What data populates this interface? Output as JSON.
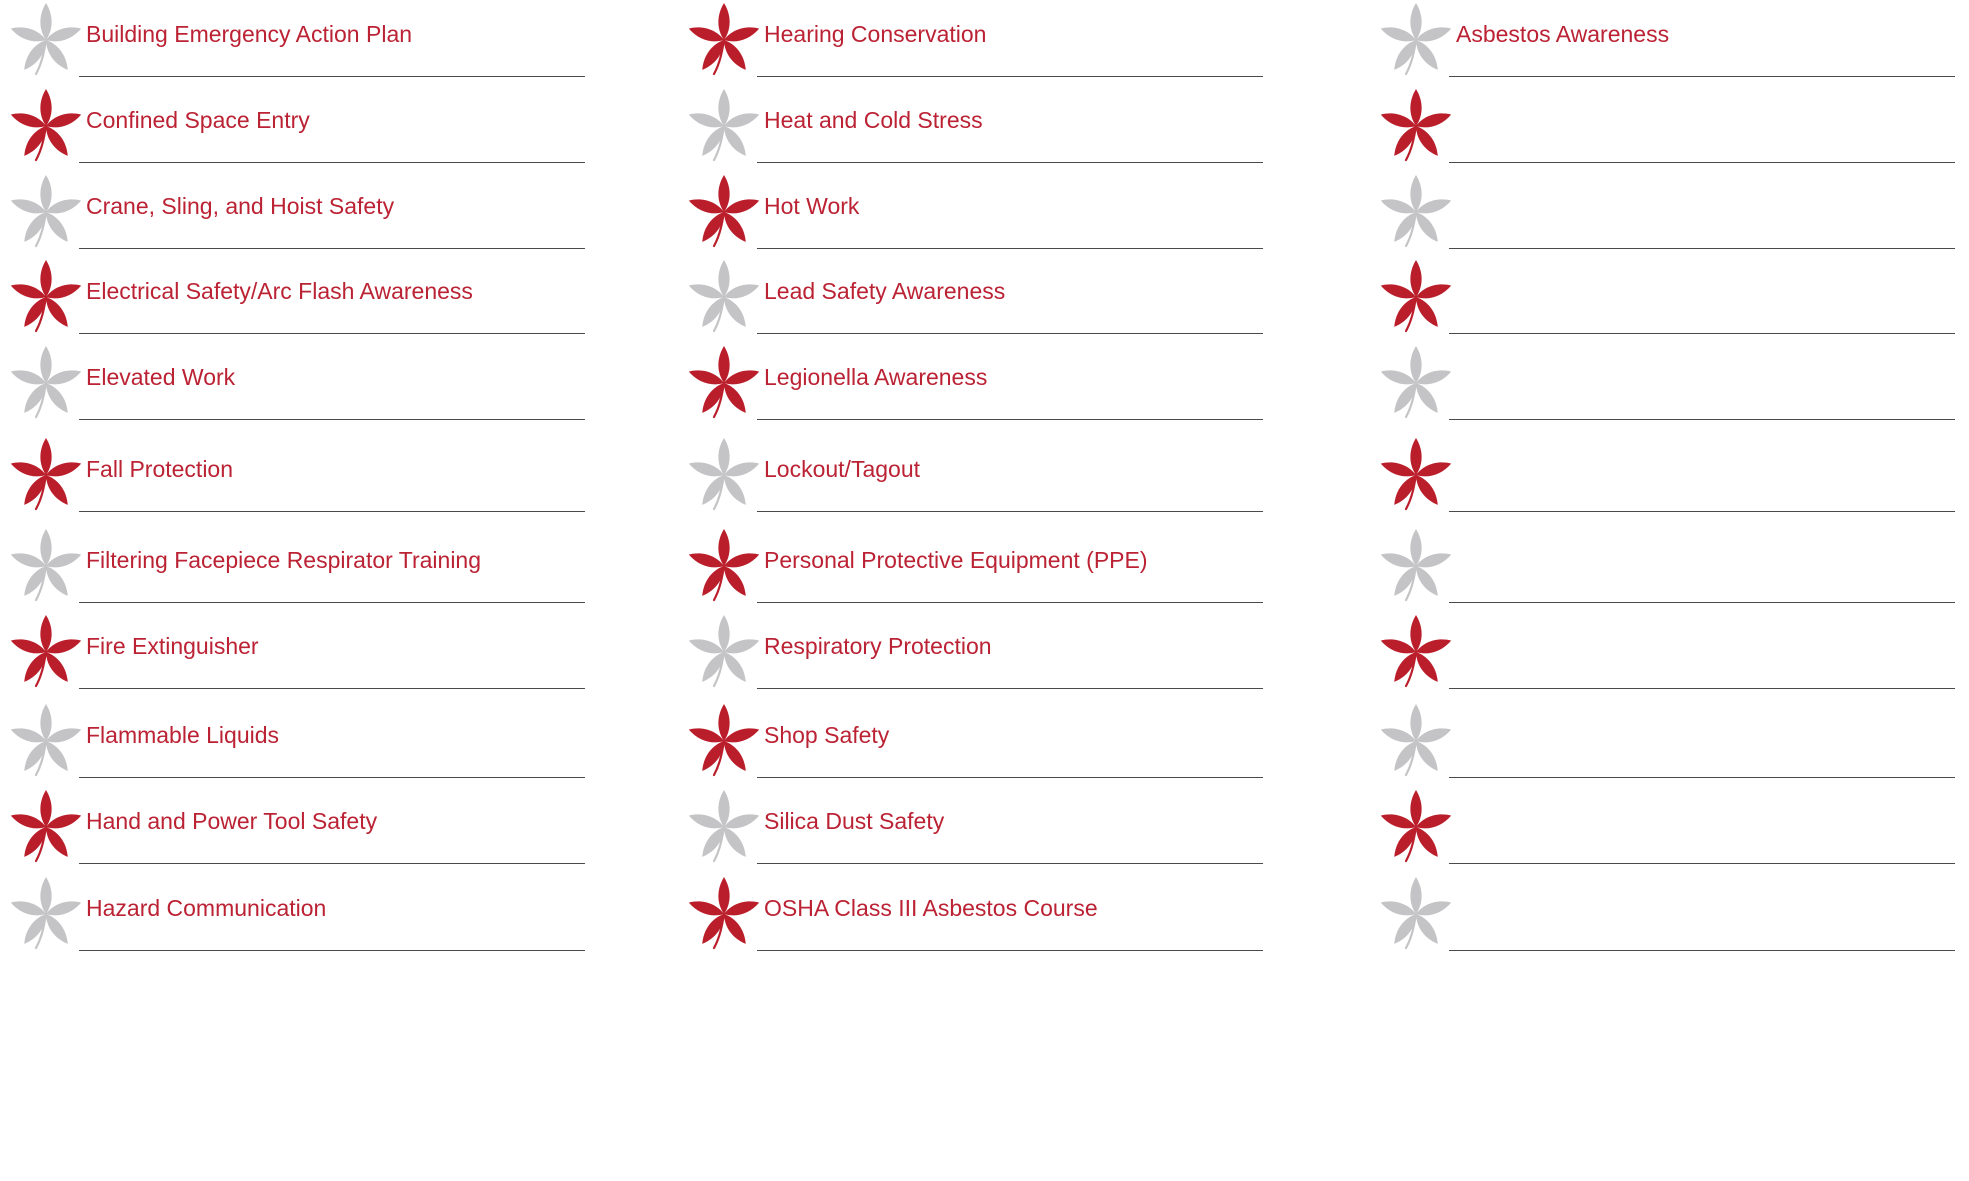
{
  "columns": [
    {
      "items": [
        {
          "label": "Building Emergency Action Plan",
          "icon": "buckeye-leaf-icon",
          "color": "grey"
        },
        {
          "label": "Confined Space Entry",
          "icon": "buckeye-leaf-icon",
          "color": "red"
        },
        {
          "label": "Crane, Sling, and Hoist Safety",
          "icon": "buckeye-leaf-icon",
          "color": "grey"
        },
        {
          "label": "Electrical Safety/Arc Flash Awareness",
          "icon": "buckeye-leaf-icon",
          "color": "red"
        },
        {
          "label": "Elevated Work",
          "icon": "buckeye-leaf-icon",
          "color": "grey"
        },
        {
          "label": "Fall Protection",
          "icon": "buckeye-leaf-icon",
          "color": "red"
        },
        {
          "label": "Filtering Facepiece Respirator Training",
          "icon": "buckeye-leaf-icon",
          "color": "grey"
        },
        {
          "label": "Fire Extinguisher",
          "icon": "buckeye-leaf-icon",
          "color": "red"
        },
        {
          "label": "Flammable Liquids",
          "icon": "buckeye-leaf-icon",
          "color": "grey"
        },
        {
          "label": "Hand and Power Tool Safety",
          "icon": "buckeye-leaf-icon",
          "color": "red"
        },
        {
          "label": "Hazard Communication",
          "icon": "buckeye-leaf-icon",
          "color": "grey"
        }
      ]
    },
    {
      "items": [
        {
          "label": "Hearing Conservation",
          "icon": "buckeye-leaf-icon",
          "color": "red"
        },
        {
          "label": "Heat and Cold Stress",
          "icon": "buckeye-leaf-icon",
          "color": "grey"
        },
        {
          "label": "Hot Work",
          "icon": "buckeye-leaf-icon",
          "color": "red"
        },
        {
          "label": "Lead Safety Awareness",
          "icon": "buckeye-leaf-icon",
          "color": "grey"
        },
        {
          "label": "Legionella Awareness",
          "icon": "buckeye-leaf-icon",
          "color": "red"
        },
        {
          "label": "Lockout/Tagout",
          "icon": "buckeye-leaf-icon",
          "color": "grey"
        },
        {
          "label": "Personal Protective Equipment (PPE)",
          "icon": "buckeye-leaf-icon",
          "color": "red"
        },
        {
          "label": "Respiratory Protection",
          "icon": "buckeye-leaf-icon",
          "color": "grey"
        },
        {
          "label": "Shop Safety",
          "icon": "buckeye-leaf-icon",
          "color": "red"
        },
        {
          "label": "Silica Dust Safety",
          "icon": "buckeye-leaf-icon",
          "color": "grey"
        },
        {
          "label": "OSHA Class III Asbestos Course",
          "icon": "buckeye-leaf-icon",
          "color": "red"
        }
      ]
    },
    {
      "items": [
        {
          "label": "Asbestos Awareness",
          "icon": "buckeye-leaf-icon",
          "color": "grey"
        },
        {
          "label": "",
          "icon": "buckeye-leaf-icon",
          "color": "red"
        },
        {
          "label": "",
          "icon": "buckeye-leaf-icon",
          "color": "grey"
        },
        {
          "label": "",
          "icon": "buckeye-leaf-icon",
          "color": "red"
        },
        {
          "label": "",
          "icon": "buckeye-leaf-icon",
          "color": "grey"
        },
        {
          "label": "",
          "icon": "buckeye-leaf-icon",
          "color": "red"
        },
        {
          "label": "",
          "icon": "buckeye-leaf-icon",
          "color": "grey"
        },
        {
          "label": "",
          "icon": "buckeye-leaf-icon",
          "color": "red"
        },
        {
          "label": "",
          "icon": "buckeye-leaf-icon",
          "color": "grey"
        },
        {
          "label": "",
          "icon": "buckeye-leaf-icon",
          "color": "red"
        },
        {
          "label": "",
          "icon": "buckeye-leaf-icon",
          "color": "grey"
        }
      ]
    }
  ],
  "colors": {
    "leaf_red": "#bb1e2b",
    "leaf_grey": "#c4c4c6",
    "label_text": "#bb2234",
    "line": "#4a4a4a"
  }
}
